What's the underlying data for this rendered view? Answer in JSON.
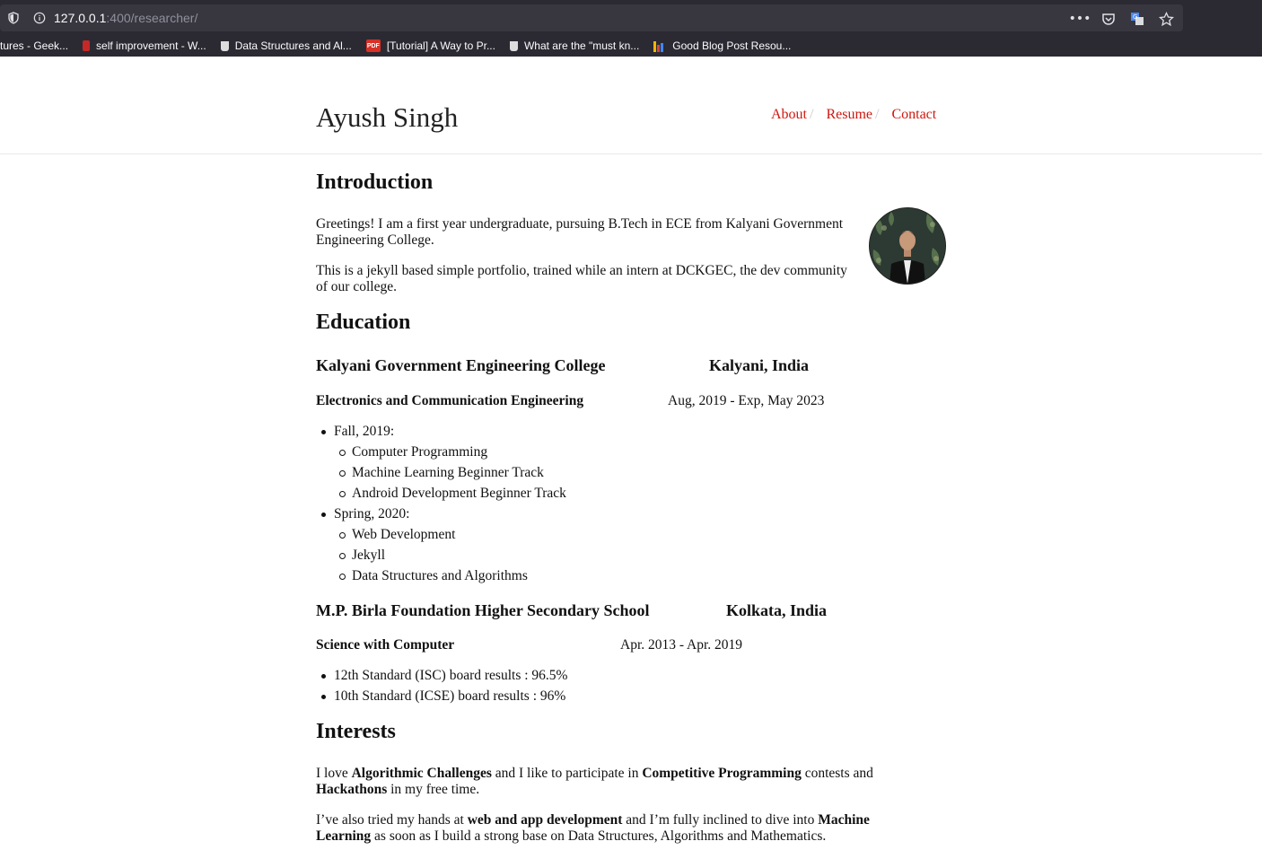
{
  "browser": {
    "url_host": "127.0.0.1",
    "url_rest": ":400/researcher/",
    "bookmarks": [
      {
        "label": "tures - Geek...",
        "icon": "bookmark-icon"
      },
      {
        "label": "self improvement - W...",
        "icon": "red-bookmark-icon"
      },
      {
        "label": "Data Structures and Al...",
        "icon": "cup-icon"
      },
      {
        "label": "[Tutorial] A Way to Pr...",
        "icon": "pdf-icon"
      },
      {
        "label": "What are the \"must kn...",
        "icon": "cup-icon"
      },
      {
        "label": "Good Blog Post Resou...",
        "icon": "bar-chart-icon"
      }
    ]
  },
  "site": {
    "title": "Ayush Singh",
    "nav": [
      {
        "label": "About"
      },
      {
        "label": "Resume"
      },
      {
        "label": "Contact"
      }
    ],
    "nav_separator": "/"
  },
  "intro": {
    "heading": "Introduction",
    "p1": "Greetings! I am a first year undergraduate, pursuing B.Tech in ECE from Kalyani Government Engineering College.",
    "p2": "This is a jekyll based simple portfolio, trained while an intern at DCKGEC, the dev community of our college."
  },
  "education": {
    "heading": "Education",
    "schools": [
      {
        "name": "Kalyani Government Engineering College",
        "location": "Kalyani, India",
        "degree": "Electronics and Communication Engineering",
        "dates": "Aug, 2019 - Exp, May 2023",
        "items": [
          {
            "label": "Fall, 2019:",
            "sub": [
              "Computer Programming",
              "Machine Learning Beginner Track",
              "Android Development Beginner Track"
            ]
          },
          {
            "label": "Spring, 2020:",
            "sub": [
              "Web Development",
              "Jekyll",
              "Data Structures and Algorithms"
            ]
          }
        ]
      },
      {
        "name": "M.P. Birla Foundation Higher Secondary School",
        "location": "Kolkata, India",
        "degree": "Science with Computer",
        "dates": "Apr. 2013 - Apr. 2019",
        "items": [
          {
            "label": "12th Standard (ISC) board results : 96.5%"
          },
          {
            "label": "10th Standard (ICSE) board results : 96%"
          }
        ]
      }
    ]
  },
  "interests": {
    "heading": "Interests",
    "p1": {
      "t1": "I love ",
      "b1": "Algorithmic Challenges",
      "t2": " and I like to participate in ",
      "b2": "Competitive Programming",
      "t3": " contests and ",
      "b3": "Hackathons",
      "t4": " in my free time."
    },
    "p2": {
      "t1": "I’ve also tried my hands at ",
      "b1": "web and app development",
      "t2": " and I’m fully inclined to dive into ",
      "b2": "Machine Learning",
      "t3": " as soon as I build a strong base on Data Structures, Algorithms and Mathematics."
    }
  },
  "colors": {
    "link": "#d0160d",
    "chrome": "#2b2a33",
    "urlbar": "#38373f"
  }
}
